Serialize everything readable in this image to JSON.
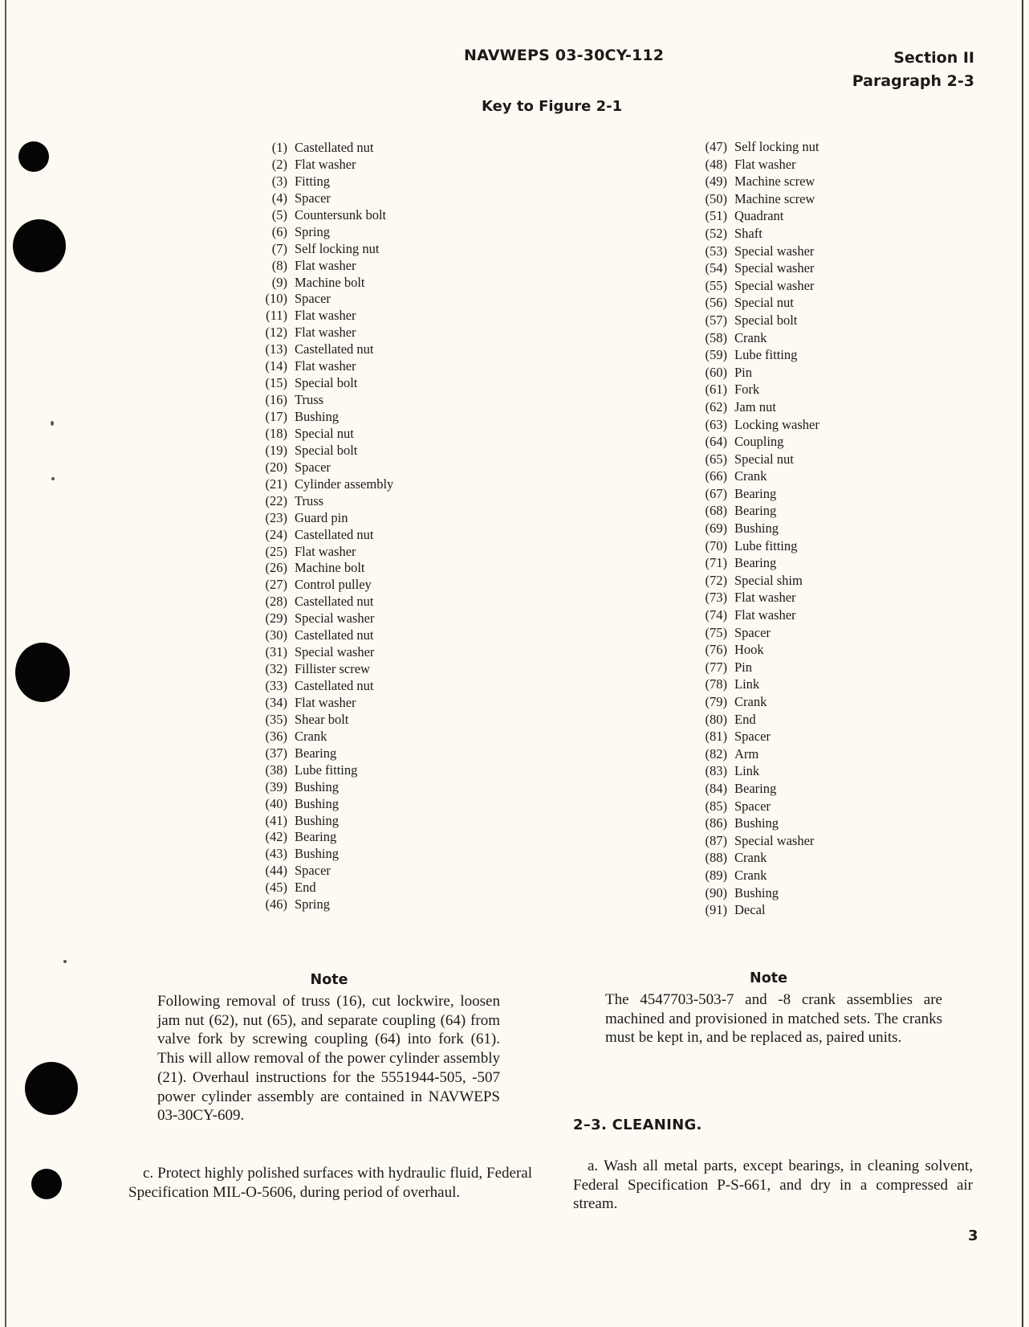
{
  "header": {
    "document_number": "NAVWEPS 03-30CY-112",
    "section": "Section II",
    "paragraph": "Paragraph 2-3"
  },
  "key_title": "Key to Figure 2-1",
  "parts_left": [
    {
      "num": "(1)",
      "name": "Castellated nut"
    },
    {
      "num": "(2)",
      "name": "Flat washer"
    },
    {
      "num": "(3)",
      "name": "Fitting"
    },
    {
      "num": "(4)",
      "name": "Spacer"
    },
    {
      "num": "(5)",
      "name": "Countersunk bolt"
    },
    {
      "num": "(6)",
      "name": "Spring"
    },
    {
      "num": "(7)",
      "name": "Self locking nut"
    },
    {
      "num": "(8)",
      "name": "Flat washer"
    },
    {
      "num": "(9)",
      "name": "Machine bolt"
    },
    {
      "num": "(10)",
      "name": "Spacer"
    },
    {
      "num": "(11)",
      "name": "Flat washer"
    },
    {
      "num": "(12)",
      "name": "Flat washer"
    },
    {
      "num": "(13)",
      "name": "Castellated nut"
    },
    {
      "num": "(14)",
      "name": "Flat washer"
    },
    {
      "num": "(15)",
      "name": "Special bolt"
    },
    {
      "num": "(16)",
      "name": "Truss"
    },
    {
      "num": "(17)",
      "name": "Bushing"
    },
    {
      "num": "(18)",
      "name": "Special nut"
    },
    {
      "num": "(19)",
      "name": "Special bolt"
    },
    {
      "num": "(20)",
      "name": "Spacer"
    },
    {
      "num": "(21)",
      "name": "Cylinder assembly"
    },
    {
      "num": "(22)",
      "name": "Truss"
    },
    {
      "num": "(23)",
      "name": "Guard pin"
    },
    {
      "num": "(24)",
      "name": "Castellated nut"
    },
    {
      "num": "(25)",
      "name": "Flat washer"
    },
    {
      "num": "(26)",
      "name": "Machine bolt"
    },
    {
      "num": "(27)",
      "name": "Control pulley"
    },
    {
      "num": "(28)",
      "name": "Castellated nut"
    },
    {
      "num": "(29)",
      "name": "Special washer"
    },
    {
      "num": "(30)",
      "name": "Castellated nut"
    },
    {
      "num": "(31)",
      "name": "Special washer"
    },
    {
      "num": "(32)",
      "name": "Fillister screw"
    },
    {
      "num": "(33)",
      "name": "Castellated nut"
    },
    {
      "num": "(34)",
      "name": "Flat washer"
    },
    {
      "num": "(35)",
      "name": "Shear bolt"
    },
    {
      "num": "(36)",
      "name": "Crank"
    },
    {
      "num": "(37)",
      "name": "Bearing"
    },
    {
      "num": "(38)",
      "name": "Lube fitting"
    },
    {
      "num": "(39)",
      "name": "Bushing"
    },
    {
      "num": "(40)",
      "name": "Bushing"
    },
    {
      "num": "(41)",
      "name": "Bushing"
    },
    {
      "num": "(42)",
      "name": "Bearing"
    },
    {
      "num": "(43)",
      "name": "Bushing"
    },
    {
      "num": "(44)",
      "name": "Spacer"
    },
    {
      "num": "(45)",
      "name": "End"
    },
    {
      "num": "(46)",
      "name": "Spring"
    }
  ],
  "parts_right": [
    {
      "num": "(47)",
      "name": "Self locking nut"
    },
    {
      "num": "(48)",
      "name": "Flat washer"
    },
    {
      "num": "(49)",
      "name": "Machine screw"
    },
    {
      "num": "(50)",
      "name": "Machine screw"
    },
    {
      "num": "(51)",
      "name": "Quadrant"
    },
    {
      "num": "(52)",
      "name": "Shaft"
    },
    {
      "num": "(53)",
      "name": "Special washer"
    },
    {
      "num": "(54)",
      "name": "Special washer"
    },
    {
      "num": "(55)",
      "name": "Special washer"
    },
    {
      "num": "(56)",
      "name": "Special nut"
    },
    {
      "num": "(57)",
      "name": "Special bolt"
    },
    {
      "num": "(58)",
      "name": "Crank"
    },
    {
      "num": "(59)",
      "name": "Lube fitting"
    },
    {
      "num": "(60)",
      "name": "Pin"
    },
    {
      "num": "(61)",
      "name": "Fork"
    },
    {
      "num": "(62)",
      "name": "Jam nut"
    },
    {
      "num": "(63)",
      "name": "Locking washer"
    },
    {
      "num": "(64)",
      "name": "Coupling"
    },
    {
      "num": "(65)",
      "name": "Special nut"
    },
    {
      "num": "(66)",
      "name": "Crank"
    },
    {
      "num": "(67)",
      "name": "Bearing"
    },
    {
      "num": "(68)",
      "name": "Bearing"
    },
    {
      "num": "(69)",
      "name": "Bushing"
    },
    {
      "num": "(70)",
      "name": "Lube fitting"
    },
    {
      "num": "(71)",
      "name": "Bearing"
    },
    {
      "num": "(72)",
      "name": "Special shim"
    },
    {
      "num": "(73)",
      "name": "Flat washer"
    },
    {
      "num": "(74)",
      "name": "Flat washer"
    },
    {
      "num": "(75)",
      "name": "Spacer"
    },
    {
      "num": "(76)",
      "name": "Hook"
    },
    {
      "num": "(77)",
      "name": "Pin"
    },
    {
      "num": "(78)",
      "name": "Link"
    },
    {
      "num": "(79)",
      "name": "Crank"
    },
    {
      "num": "(80)",
      "name": "End"
    },
    {
      "num": "(81)",
      "name": "Spacer"
    },
    {
      "num": "(82)",
      "name": "Arm"
    },
    {
      "num": "(83)",
      "name": "Link"
    },
    {
      "num": "(84)",
      "name": "Bearing"
    },
    {
      "num": "(85)",
      "name": "Spacer"
    },
    {
      "num": "(86)",
      "name": "Bushing"
    },
    {
      "num": "(87)",
      "name": "Special washer"
    },
    {
      "num": "(88)",
      "name": "Crank"
    },
    {
      "num": "(89)",
      "name": "Crank"
    },
    {
      "num": "(90)",
      "name": "Bushing"
    },
    {
      "num": "(91)",
      "name": "Decal"
    }
  ],
  "left_note": {
    "title": "Note",
    "text": "Following removal of truss (16), cut lockwire, loosen jam nut (62), nut (65), and separate coupling (64) from valve fork by screwing coupling (64) into fork (61). This will allow removal of the power cylinder assembly (21). Overhaul instructions for the 5551944-505, -507 power cylinder assembly are contained in NAVWEPS 03-30CY-609."
  },
  "step_c": "c. Protect highly polished surfaces with hydraulic fluid, Federal Specification MIL-O-5606, during period of overhaul.",
  "right_note": {
    "title": "Note",
    "text": "The 4547703-503-7 and -8 crank assemblies are machined and provisioned in matched sets. The cranks must be kept in, and be replaced as, paired units."
  },
  "section_heading": "2–3.  CLEANING.",
  "step_a": "a. Wash all metal parts, except bearings, in cleaning solvent, Federal Specification P-S-661, and dry in a compressed air stream.",
  "page_number": "3"
}
